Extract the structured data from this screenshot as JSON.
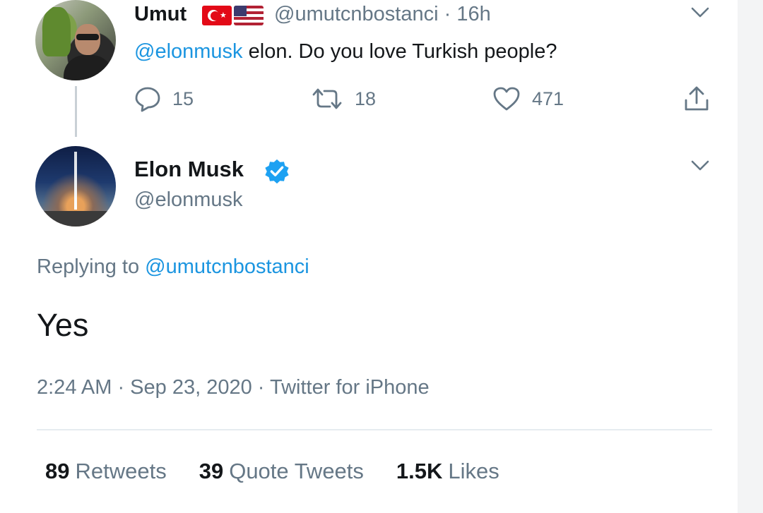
{
  "parent_tweet": {
    "display_name": "Umut",
    "handle": "@umutcnbostanci",
    "separator": "·",
    "time": "16h",
    "mention": "@elonmusk",
    "text": " elon. Do you love Turkish people?",
    "reply_count": "15",
    "retweet_count": "18",
    "like_count": "471",
    "flags": [
      "turkey-flag",
      "usa-flag"
    ]
  },
  "main_tweet": {
    "display_name": "Elon Musk",
    "handle": "@elonmusk",
    "replying_prefix": "Replying to ",
    "replying_to": "@umutcnbostanci",
    "text": "Yes",
    "timestamp": "2:24 AM · Sep 23, 2020 · Twitter for iPhone",
    "retweets_count": "89",
    "retweets_label": "Retweets",
    "quote_count": "39",
    "quote_label": "Quote Tweets",
    "likes_count": "1.5K",
    "likes_label": "Likes"
  },
  "colors": {
    "link": "#1b95e0",
    "secondary_text": "#657786",
    "primary_text": "#14171a",
    "verified_badge": "#1da1f2"
  },
  "icons": {
    "reply": "speech-bubble-icon",
    "retweet": "retweet-arrows-icon",
    "like": "heart-icon",
    "share": "share-upload-icon",
    "more": "chevron-down-icon",
    "verified": "verified-badge-icon"
  }
}
